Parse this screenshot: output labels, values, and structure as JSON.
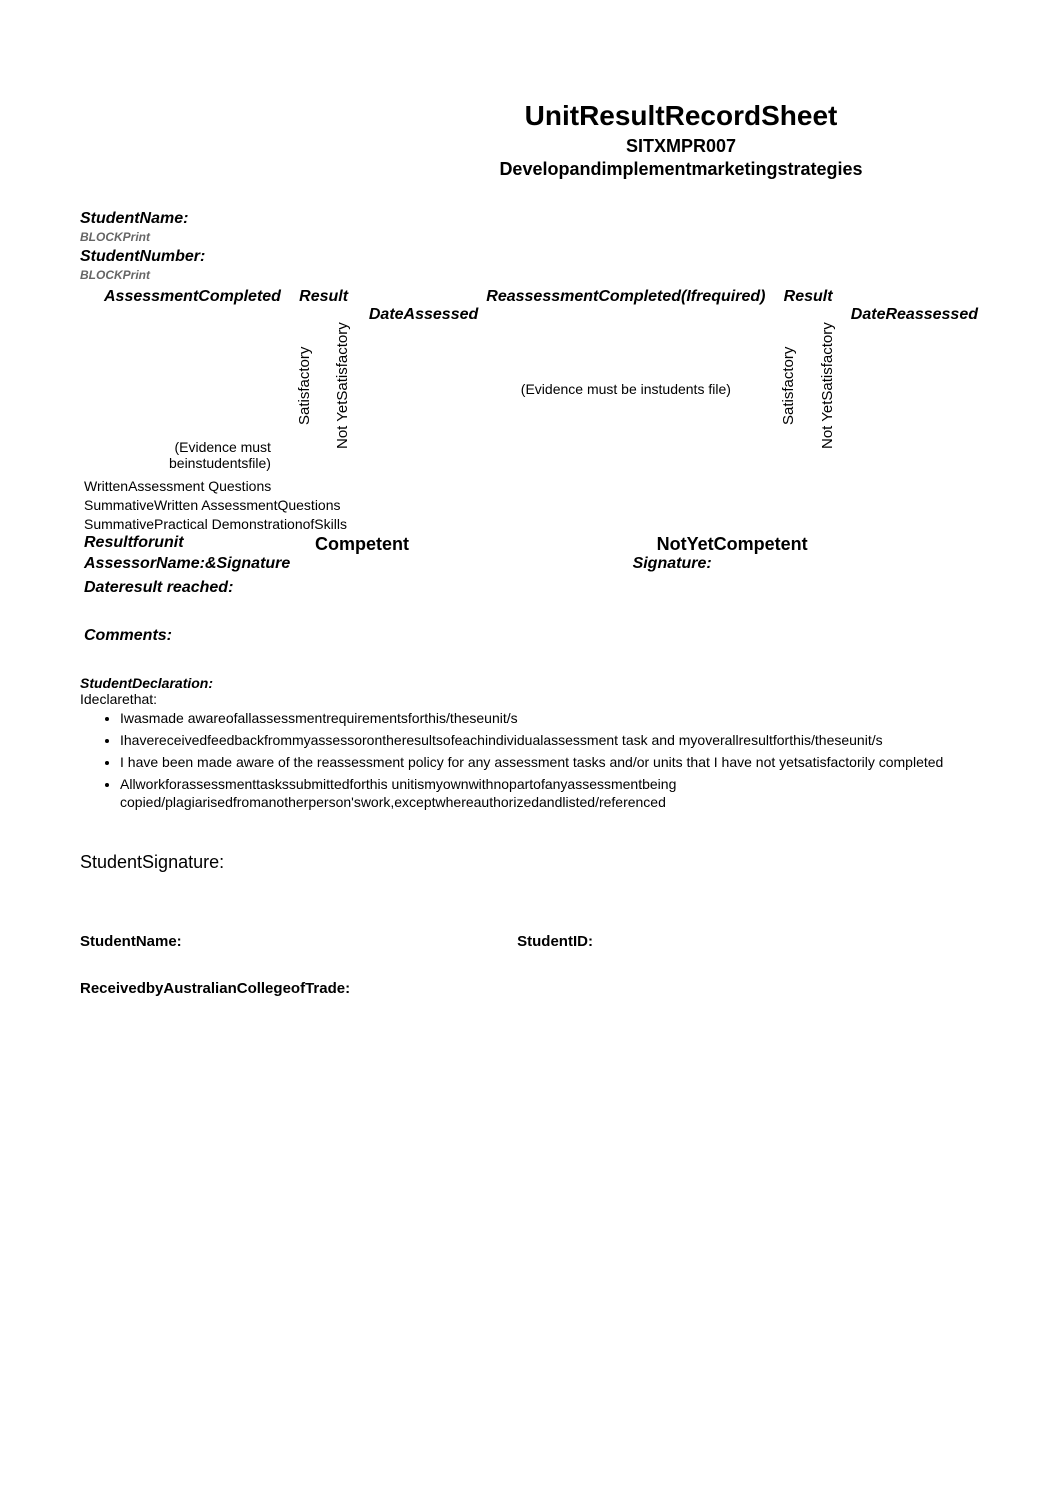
{
  "header": {
    "title": "UnitResultRecordSheet",
    "unit_code": "SITXMPR007",
    "unit_name": "Developandimplementmarketingstrategies"
  },
  "student": {
    "name_label": "StudentName:",
    "name_hint": "BLOCKPrint",
    "number_label": "StudentNumber:",
    "number_hint": "BLOCKPrint"
  },
  "table": {
    "assessment_completed": "AssessmentCompleted",
    "result1": "Result",
    "reassessment_completed": "ReassessmentCompleted(Ifrequired)",
    "result2": "Result",
    "evidence_note1": "(Evidence must beinstudentsfile)",
    "satisfactory1": "Satisfactory",
    "nys1": "Not YetSatisfactory",
    "date_assessed": "DateAssessed",
    "evidence_note2": "(Evidence must be instudents file)",
    "satisfactory2": "Satisfactory",
    "nys2": "Not YetSatisfactory",
    "date_reassessed": "DateReassessed",
    "tasks": [
      "WrittenAssessment Questions",
      "SummativeWritten AssessmentQuestions",
      "SummativePractical DemonstrationofSkills"
    ]
  },
  "results": {
    "result_for_unit": "Resultforunit",
    "competent": "Competent",
    "not_yet_competent": "NotYetCompetent",
    "assessor_label": "AssessorName:&Signature",
    "signature_label": "Signature:",
    "date_result_label": "Dateresult reached:",
    "comments_label": "Comments:"
  },
  "declaration": {
    "heading": "StudentDeclaration:",
    "intro": "Ideclarethat:",
    "items": [
      "Iwasmade awareofallassessmentrequirementsforthis/theseunit/s",
      "Ihavereceivedfeedbackfrommyassessorontheresultsofeachindividualassessment task and myoverallresultforthis/theseunit/s",
      "I have been made aware of the reassessment policy for any assessment tasks and/or units that I have not yetsatisfactorily completed",
      "Allworkforassessmenttaskssubmittedforthis unitismyownwithnopartofanyassessmentbeing copied/plagiarisedfromanotherperson'swork,exceptwhereauthorizedandlisted/referenced"
    ],
    "student_signature": "StudentSignature:"
  },
  "footer": {
    "student_name": "StudentName:",
    "student_id": "StudentID:",
    "received_by": "ReceivedbyAustralianCollegeofTrade:"
  }
}
